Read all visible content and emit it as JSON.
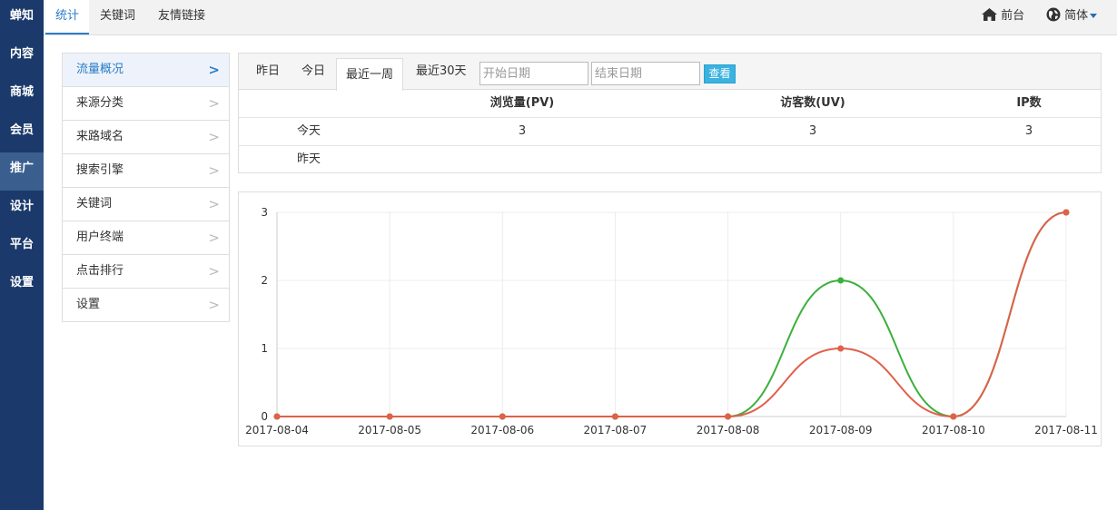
{
  "sidebar": {
    "items": [
      {
        "label": "蝉知"
      },
      {
        "label": "内容"
      },
      {
        "label": "商城"
      },
      {
        "label": "会员"
      },
      {
        "label": "推广",
        "active": true
      },
      {
        "label": "设计"
      },
      {
        "label": "平台"
      },
      {
        "label": "设置"
      }
    ]
  },
  "topbar": {
    "tabs": [
      {
        "label": "统计",
        "active": true
      },
      {
        "label": "关键词"
      },
      {
        "label": "友情链接"
      }
    ],
    "frontend_label": "前台",
    "frontend_icon": "home-icon",
    "language_label": "简体",
    "language_icon": "globe-icon"
  },
  "submenu": {
    "items": [
      {
        "label": "流量概况",
        "active": true
      },
      {
        "label": "来源分类"
      },
      {
        "label": "来路域名"
      },
      {
        "label": "搜索引擎"
      },
      {
        "label": "关键词"
      },
      {
        "label": "用户终端"
      },
      {
        "label": "点击排行"
      },
      {
        "label": "设置"
      }
    ]
  },
  "stats": {
    "tabs": [
      {
        "label": "昨日"
      },
      {
        "label": "今日"
      },
      {
        "label": "最近一周",
        "active": true
      },
      {
        "label": "最近30天"
      }
    ],
    "start_placeholder": "开始日期",
    "end_placeholder": "结束日期",
    "view_button": "查看",
    "columns": [
      "",
      "浏览量(PV)",
      "访客数(UV)",
      "IP数"
    ],
    "rows": [
      {
        "label": "今天",
        "pv": "3",
        "uv": "3",
        "ip": "3"
      },
      {
        "label": "昨天",
        "pv": "",
        "uv": "",
        "ip": ""
      }
    ]
  },
  "chart_data": {
    "type": "line",
    "x": [
      "2017-08-04",
      "2017-08-05",
      "2017-08-06",
      "2017-08-07",
      "2017-08-08",
      "2017-08-09",
      "2017-08-10",
      "2017-08-11"
    ],
    "yticks": [
      0,
      1,
      2,
      3
    ],
    "ylim": [
      0,
      3
    ],
    "grid": true,
    "series": [
      {
        "color": "#3cb03c",
        "values": [
          0,
          0,
          0,
          0,
          0,
          2,
          0,
          3
        ]
      },
      {
        "color": "#e0604a",
        "values": [
          0,
          0,
          0,
          0,
          0,
          1,
          0,
          3
        ]
      }
    ]
  }
}
